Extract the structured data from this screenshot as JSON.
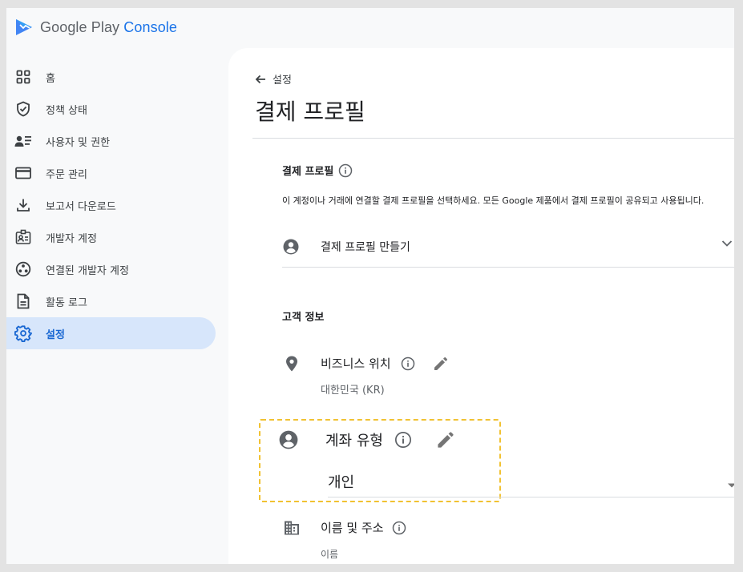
{
  "app": {
    "logo_google_play": "Google Play",
    "logo_console": "Console"
  },
  "sidebar": {
    "items": [
      {
        "label": "홈",
        "icon": "dashboard-icon"
      },
      {
        "label": "정책 상태",
        "icon": "shield-check-icon"
      },
      {
        "label": "사용자 및 권한",
        "icon": "users-list-icon"
      },
      {
        "label": "주문 관리",
        "icon": "credit-card-icon"
      },
      {
        "label": "보고서 다운로드",
        "icon": "download-icon"
      },
      {
        "label": "개발자 계정",
        "icon": "badge-icon"
      },
      {
        "label": "연결된 개발자 계정",
        "icon": "linked-accounts-icon"
      },
      {
        "label": "활동 로그",
        "icon": "document-icon"
      },
      {
        "label": "설정",
        "icon": "gear-icon",
        "active": true
      }
    ]
  },
  "header": {
    "back_label": "설정",
    "title": "결제 프로필"
  },
  "payment_profile": {
    "section_title": "결제 프로필",
    "description": "이 계정이나 거래에 연결할 결제 프로필을 선택하세요. 모든 Google 제품에서 결제 프로필이 공유되고 사용됩니다.",
    "create_label": "결제 프로필 만들기"
  },
  "customer_info": {
    "section_title": "고객 정보",
    "business_location": {
      "label": "비즈니스 위치",
      "value": "대한민국 (KR)"
    },
    "account_type": {
      "label": "계좌 유형",
      "value": "개인"
    },
    "name_address": {
      "label": "이름 및 주소",
      "value": "이름"
    }
  },
  "colors": {
    "accent": "#1a73e8",
    "active_nav_bg": "#d7e6fb",
    "highlight_border": "#f1c232"
  }
}
